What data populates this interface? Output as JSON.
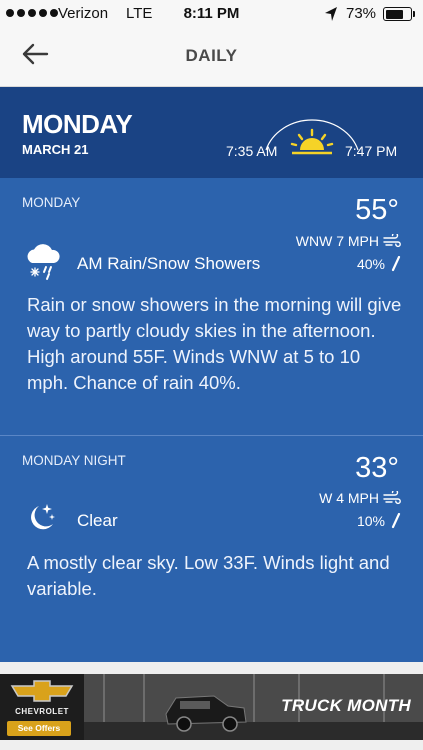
{
  "status_bar": {
    "carrier": "Verizon",
    "network": "LTE",
    "time": "8:11 PM",
    "battery_percent": "73%",
    "battery_level": 0.73
  },
  "nav": {
    "title": "DAILY",
    "back_icon": "arrow-left-icon"
  },
  "day_header": {
    "day": "MONDAY",
    "date": "MARCH 21",
    "sunrise": "7:35 AM",
    "sunset": "7:47 PM",
    "sun_icon": "sun-arc-icon"
  },
  "periods": [
    {
      "label": "MONDAY",
      "temperature": "55°",
      "wind": "WNW 7 MPH",
      "precip_chance": "40%",
      "condition": "AM Rain/Snow Showers",
      "condition_icon": "rain-snow-cloud-icon",
      "narrative": "Rain or snow showers in the morning will give way to partly cloudy skies in the afternoon. High around 55F. Winds WNW at 5 to 10 mph. Chance of rain 40%."
    },
    {
      "label": "MONDAY NIGHT",
      "temperature": "33°",
      "wind": "W 4 MPH",
      "precip_chance": "10%",
      "condition": "Clear",
      "condition_icon": "moon-stars-icon",
      "narrative": "A mostly clear sky. Low 33F. Winds light and variable."
    }
  ],
  "ad": {
    "brand": "CHEVROLET",
    "cta": "See Offers",
    "headline": "TRUCK MONTH"
  },
  "colors": {
    "background": "#2c63ad",
    "header": "#1a4384",
    "sun": "#f5d327",
    "ad_cta": "#d9a21b"
  }
}
